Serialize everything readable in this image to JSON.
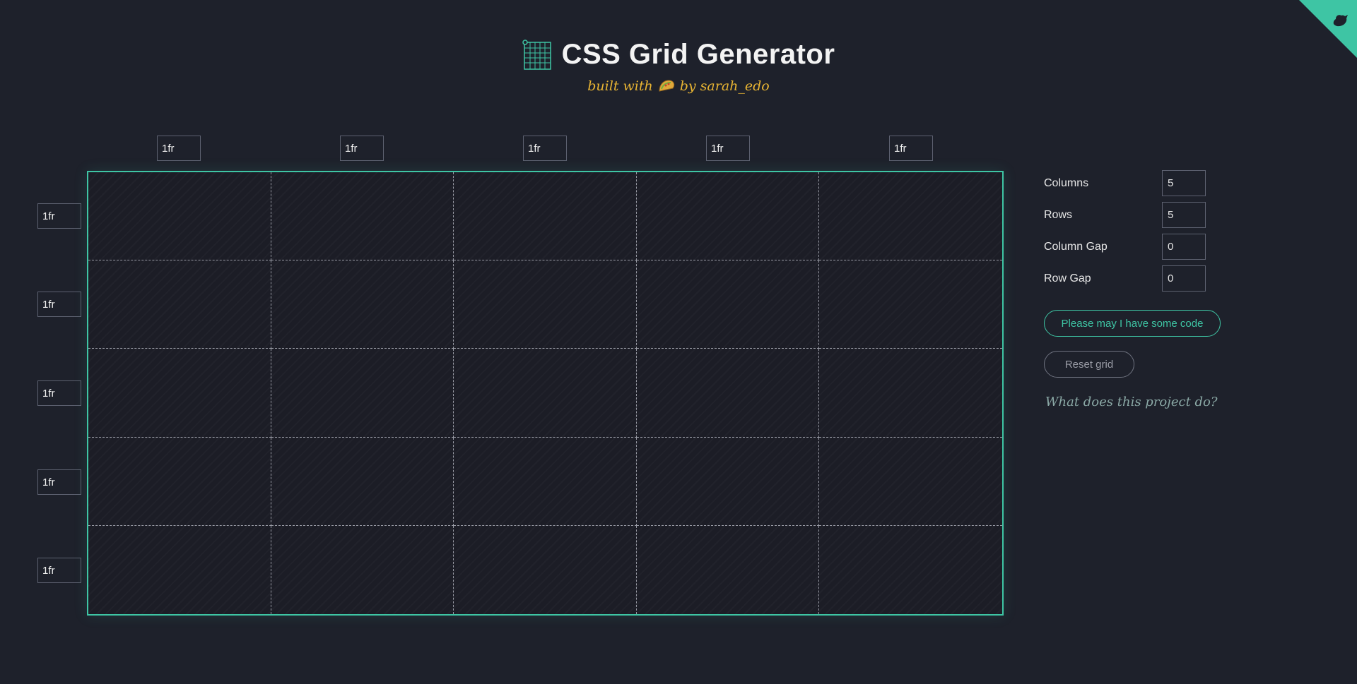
{
  "header": {
    "title": "CSS Grid Generator",
    "subtitle_prefix": "built with",
    "subtitle_suffix": "by sarah_edo"
  },
  "grid": {
    "columns": [
      "1fr",
      "1fr",
      "1fr",
      "1fr",
      "1fr"
    ],
    "rows": [
      "1fr",
      "1fr",
      "1fr",
      "1fr",
      "1fr"
    ]
  },
  "controls": {
    "columns_label": "Columns",
    "columns_value": "5",
    "rows_label": "Rows",
    "rows_value": "5",
    "column_gap_label": "Column Gap",
    "column_gap_value": "0",
    "row_gap_label": "Row Gap",
    "row_gap_value": "0",
    "code_button": "Please may I have some code",
    "reset_button": "Reset grid",
    "about_link": "What does this project do?"
  },
  "colors": {
    "background": "#1e212b",
    "accent": "#3ec5a4",
    "subtitle": "#e9b533"
  },
  "icons": {
    "logo": "grid-icon",
    "taco": "taco-icon",
    "corner": "github-cat-icon"
  }
}
